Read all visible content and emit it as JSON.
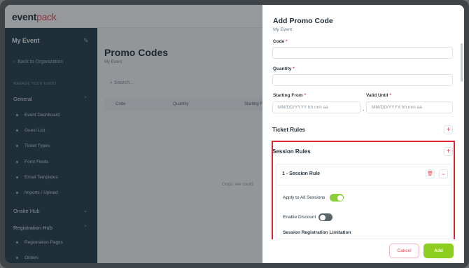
{
  "app": {
    "logo_main": "event",
    "logo_accent": "pack"
  },
  "sidebar": {
    "event_name": "My Event",
    "back_link": "Back to Organization",
    "section_label": "MANAGE YOUR EVENT",
    "groups": [
      {
        "label": "General"
      },
      {
        "label": "Onsite Hub"
      },
      {
        "label": "Registration Hub"
      }
    ],
    "general_items": [
      "Event Dashboard",
      "Guest List",
      "Ticket Types",
      "Form Fields",
      "Email Templates",
      "Imports / Upload"
    ],
    "registration_items": [
      "Registration Pages",
      "Orders"
    ]
  },
  "main": {
    "title": "Promo Codes",
    "subtitle": "My Event",
    "search_placeholder": "Search...",
    "columns": [
      "Code",
      "Quantity",
      "Starting Fr"
    ],
    "empty_text": "Oops, we could"
  },
  "panel": {
    "title": "Add Promo Code",
    "subtitle": "My Event",
    "code_label": "Code",
    "quantity_label": "Quantity",
    "start_label": "Starting From",
    "until_label": "Valid Until",
    "required_mark": "*",
    "date_placeholder": "MM/DD/YYYY hh:mm aa",
    "date_separator": "-",
    "ticket_rules_title": "Ticket Rules",
    "session_rules_title": "Session Rules",
    "plus_glyph": "+",
    "rule_card": {
      "title": "1 - Session Rule",
      "apply_all_label": "Apply to All Sessions",
      "apply_all_on": true,
      "enable_discount_label": "Enable Discount",
      "enable_discount_on": false,
      "limitation_label": "Session Registration Limitation"
    },
    "cancel_label": "Cancel",
    "add_label": "Add"
  },
  "colors": {
    "accent": "#e2485a",
    "primary_button": "#8ccd1e",
    "sidebar_bg": "#1f3947",
    "highlight_border": "#e0232f"
  }
}
